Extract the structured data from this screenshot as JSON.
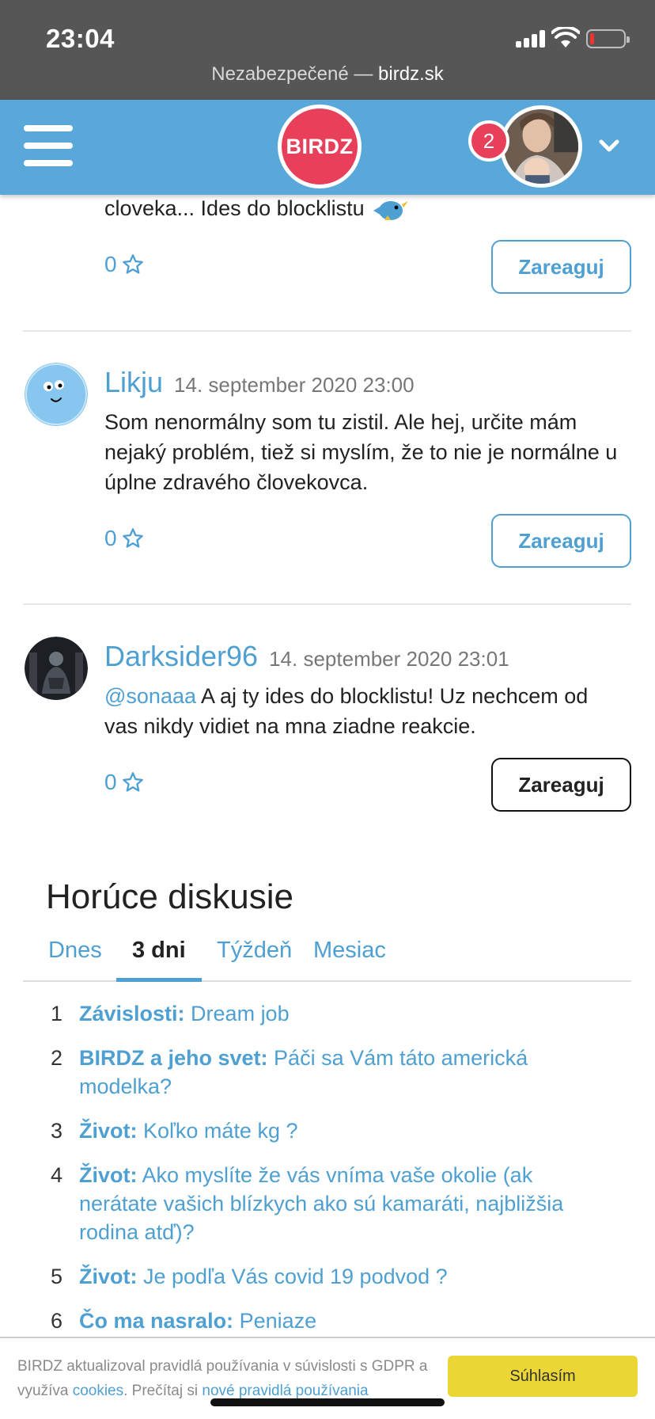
{
  "status": {
    "time": "23:04",
    "url_prefix": "Nezabezpečené — ",
    "url_host": "birdz.sk"
  },
  "header": {
    "logo": "BIRDZ",
    "notifications": "2"
  },
  "comments": [
    {
      "text": "cloveka... Ides do blocklistu",
      "rating": "0",
      "react_label": "Zareaguj"
    },
    {
      "author": "Likju",
      "date": "14. september 2020 23:00",
      "text": "Som nenormálny som tu zistil. Ale hej, určite mám nejaký problém, tiež si myslím, že to nie je normálne u úplne zdravého človekovca.",
      "rating": "0",
      "react_label": "Zareaguj"
    },
    {
      "author": "Darksider96",
      "date": "14. september 2020 23:01",
      "mention": "@sonaaa",
      "text": " A aj ty ides do blocklistu! Uz nechcem od vas nikdy vidiet na mna ziadne reakcie.",
      "rating": "0",
      "react_label": "Zareaguj"
    }
  ],
  "hot": {
    "title": "Horúce diskusie",
    "tabs": [
      "Dnes",
      "3 dni",
      "Týždeň",
      "Mesiac"
    ],
    "active_tab": "3 dni",
    "items": [
      {
        "num": "1",
        "category": "Závislosti:",
        "title": " Dream job"
      },
      {
        "num": "2",
        "category": "BIRDZ a jeho svet:",
        "title": " Páči sa Vám táto americká modelka?"
      },
      {
        "num": "3",
        "category": "Život:",
        "title": " Koľko máte kg ?"
      },
      {
        "num": "4",
        "category": "Život:",
        "title": " Ako myslíte že vás vníma vaše okolie (ak nerátate vašich blízkych ako sú kamaráti, najbližšia rodina atď)?"
      },
      {
        "num": "5",
        "category": "Život:",
        "title": " Je podľa Vás covid 19 podvod ?"
      },
      {
        "num": "6",
        "category": "Čo ma nasralo:",
        "title": " Peniaze"
      }
    ]
  },
  "cookie": {
    "text1": "BIRDZ aktualizoval pravidlá používania v súvislosti s GDPR a využíva ",
    "link1": "cookies",
    "text2": ". Prečítaj si ",
    "link2": "nové pravidlá používania",
    "accept_label": "Súhlasím"
  }
}
